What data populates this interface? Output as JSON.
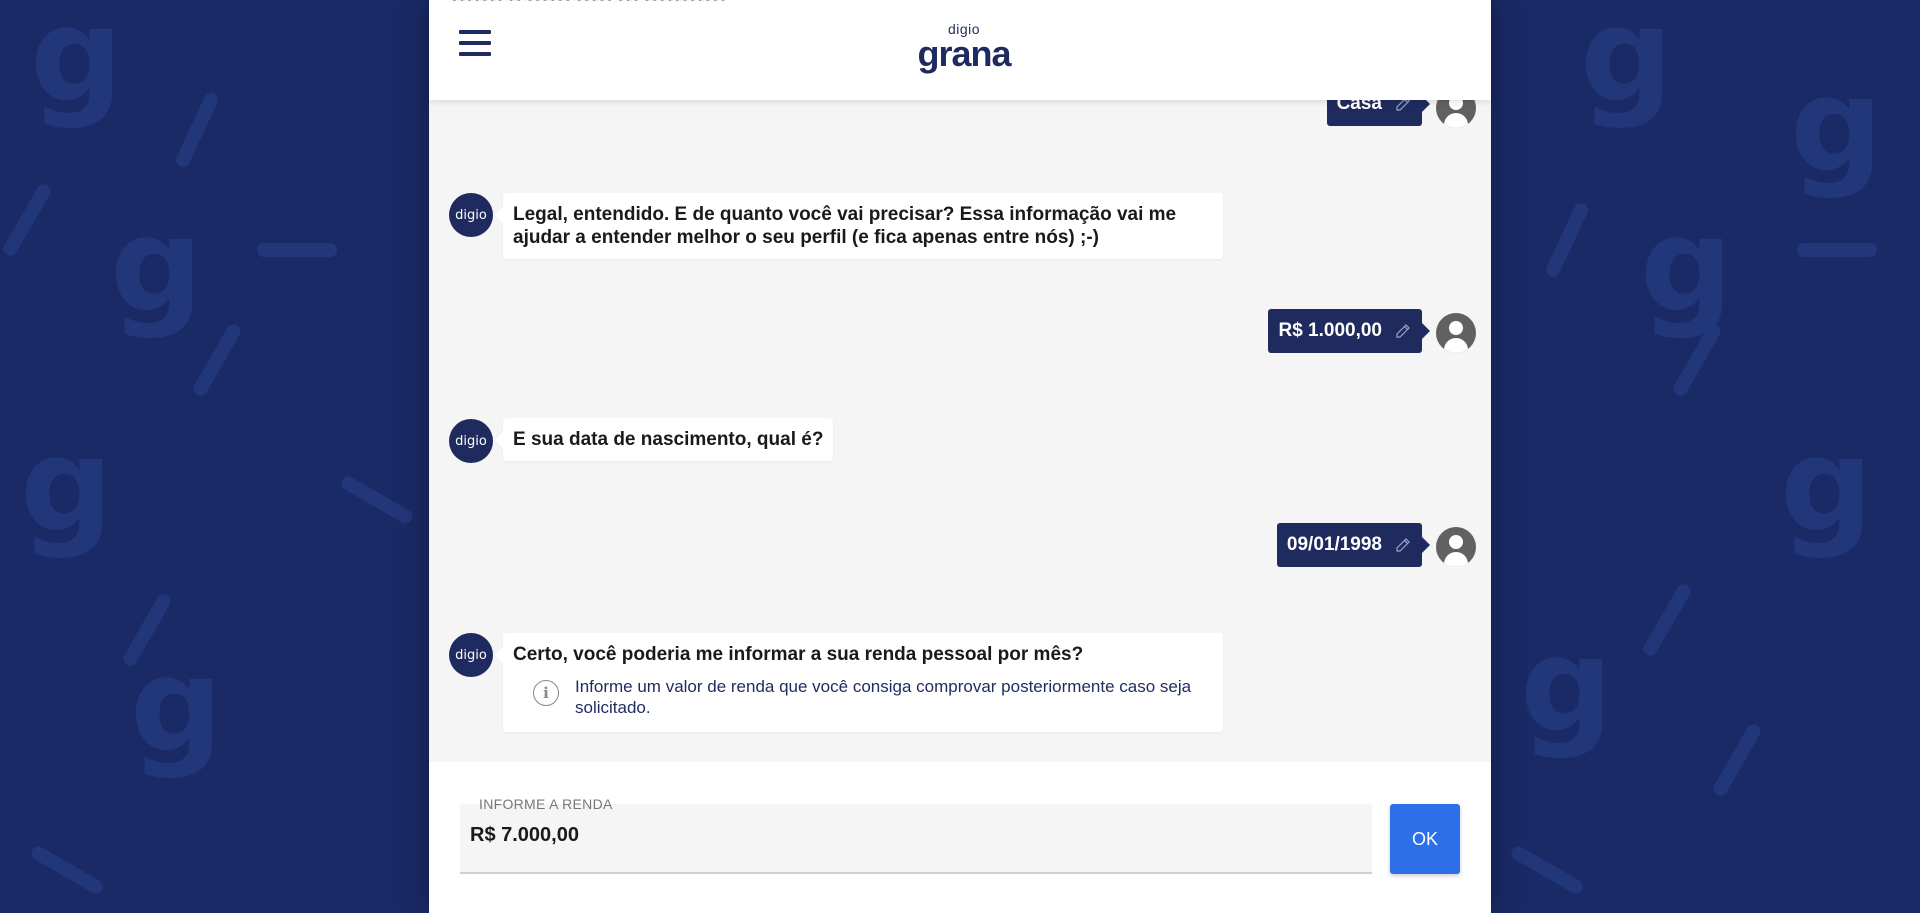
{
  "header": {
    "logo_small": "digio",
    "logo_big": "grana",
    "cut_text": "~~~~~~~ ~~ ~~~~~~ ~~~~~ ~~~ ~~~~~~~~~~~"
  },
  "chat": {
    "bot_avatar_label": "digio",
    "messages": [
      {
        "from": "user",
        "text": "Casa"
      },
      {
        "from": "bot",
        "text": "Legal, entendido. E de quanto você vai precisar? Essa informação vai me ajudar a entender melhor o seu perfil (e fica apenas entre nós) ;-)"
      },
      {
        "from": "user",
        "text": "R$ 1.000,00"
      },
      {
        "from": "bot",
        "text": "E sua data de nascimento, qual é?"
      },
      {
        "from": "user",
        "text": "09/01/1998"
      },
      {
        "from": "bot",
        "text": "Certo, você poderia me informar a sua renda pessoal por mês?",
        "info": "Informe um valor de renda que você consiga comprovar posteriormente caso seja solicitado."
      }
    ]
  },
  "input": {
    "label": "INFORME A RENDA",
    "value": "R$ 7.000,00",
    "submit_label": "OK"
  },
  "colors": {
    "brand_navy": "#1f2b5e",
    "background": "#1a2a66",
    "button_blue": "#2d6fe8"
  }
}
